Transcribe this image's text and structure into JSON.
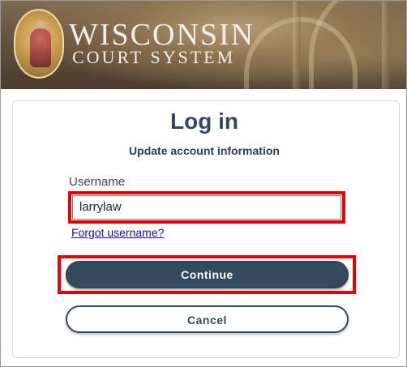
{
  "header": {
    "title_main": "WISCONSIN",
    "title_sub": "COURT SYSTEM"
  },
  "login": {
    "heading": "Log in",
    "subheading": "Update account information",
    "username_label": "Username",
    "username_value": "larrylaw",
    "forgot_link": "Forgot username?",
    "continue_label": "Continue",
    "cancel_label": "Cancel"
  },
  "colors": {
    "primary": "#34495e",
    "highlight": "#e60000",
    "link": "#1a0dab"
  }
}
